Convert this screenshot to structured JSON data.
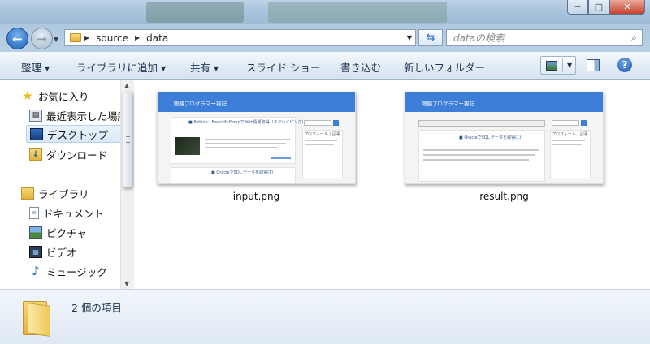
{
  "window": {
    "buttons": {
      "minimize": "─",
      "maximize": "□",
      "close": "✕"
    }
  },
  "address": {
    "segments": [
      "source",
      "data"
    ]
  },
  "search": {
    "placeholder": "dataの検索"
  },
  "toolbar": {
    "organize": "整理",
    "add_to_library": "ライブラリに追加",
    "share": "共有",
    "slideshow": "スライド ショー",
    "burn": "書き込む",
    "new_folder": "新しいフォルダー"
  },
  "nav": {
    "favorites": "お気に入り",
    "recent": "最近表示した場所",
    "desktop": "デスクトップ",
    "downloads": "ダウンロード",
    "libraries": "ライブラリ",
    "documents": "ドキュメント",
    "pictures": "ピクチャ",
    "videos": "ビデオ",
    "music": "ミュージック"
  },
  "files": [
    {
      "name": "input.png",
      "thumb_header": "眼鏡プログラマー雑記",
      "thumb_post1": "■ Python：BeautifulSoupでWeb情報取得（スクレイピング）",
      "thumb_post2": "■ OracleでSQL データを取得(1)",
      "thumb_side": "プロフィール / 記事"
    },
    {
      "name": "result.png",
      "thumb_header": "眼鏡プログラマー雑記",
      "thumb_post1": "■ OracleでSQL データを取得(1)",
      "thumb_side": "プロフィール / 記事"
    }
  ],
  "status": {
    "item_count": "2 個の項目"
  },
  "colors": {
    "accent": "#3c7ed8",
    "toolbar_text": "#1e3250"
  }
}
